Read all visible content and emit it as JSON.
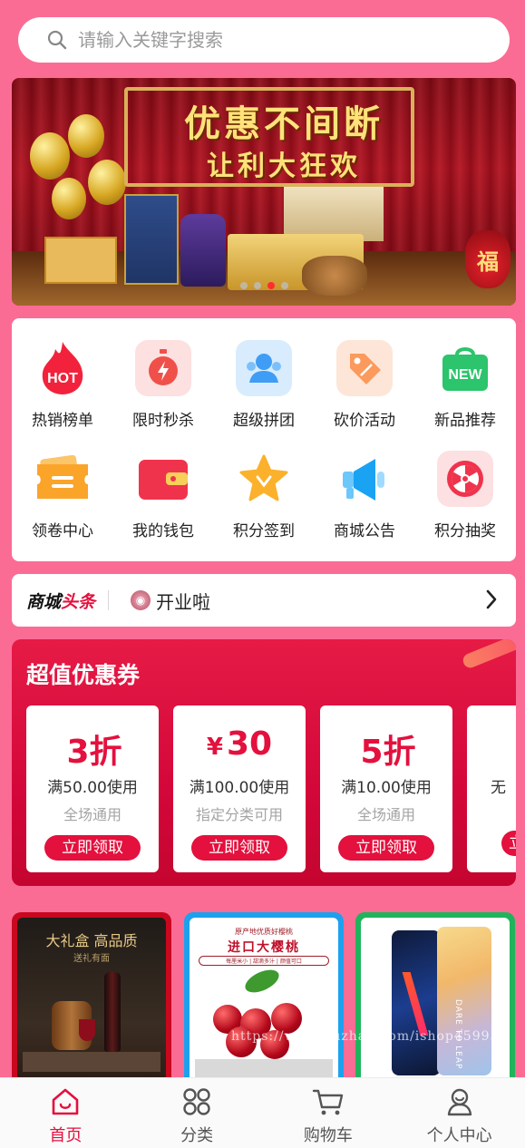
{
  "search": {
    "placeholder": "请输入关键字搜索"
  },
  "banner": {
    "title": "优惠不间断",
    "subtitle": "让利大狂欢",
    "fu": "福",
    "active_dot": 2,
    "dot_count": 4
  },
  "menu": [
    {
      "label": "热销榜单",
      "icon": "hot-flame-icon"
    },
    {
      "label": "限时秒杀",
      "icon": "stopwatch-icon"
    },
    {
      "label": "超级拼团",
      "icon": "group-users-icon"
    },
    {
      "label": "砍价活动",
      "icon": "price-tag-icon"
    },
    {
      "label": "新品推荐",
      "icon": "new-bag-icon"
    },
    {
      "label": "领卷中心",
      "icon": "ticket-icon"
    },
    {
      "label": "我的钱包",
      "icon": "wallet-icon"
    },
    {
      "label": "积分签到",
      "icon": "star-icon"
    },
    {
      "label": "商城公告",
      "icon": "megaphone-icon"
    },
    {
      "label": "积分抽奖",
      "icon": "lottery-wheel-icon"
    }
  ],
  "menu_badges": {
    "hot": "HOT",
    "new": "NEW"
  },
  "headline": {
    "brand_a": "商城",
    "brand_b": "头条",
    "text": "开业啦"
  },
  "coupons": {
    "title": "超值优惠券",
    "items": [
      {
        "value": "3",
        "unit": "折",
        "prefix": "",
        "condition": "满50.00使用",
        "scope": "全场通用",
        "button": "立即领取"
      },
      {
        "value": "30",
        "unit": "",
        "prefix": "¥",
        "condition": "满100.00使用",
        "scope": "指定分类可用",
        "button": "立即领取"
      },
      {
        "value": "5",
        "unit": "折",
        "prefix": "",
        "condition": "满10.00使用",
        "scope": "全场通用",
        "button": "立即领取"
      },
      {
        "value": "",
        "unit": "",
        "prefix": "",
        "condition": "无",
        "scope": "",
        "button": "立"
      }
    ]
  },
  "products": [
    {
      "frame_color": "#c9071f",
      "text_a": "大礼盒 高品质",
      "text_b": "送礼有面"
    },
    {
      "frame_color": "#1da1ee",
      "text_a": "原产地优质好樱桃",
      "text_b": "进口大樱桃",
      "text_c": "每厘米小 | 甜滴多汁 | 颜值可口"
    },
    {
      "frame_color": "#1fb45c",
      "text_a": "DARE TO LEAP"
    }
  ],
  "watermark": "https://www.huzhan.com/ishop45993",
  "tabs": [
    {
      "label": "首页",
      "icon": "home-icon",
      "active": true
    },
    {
      "label": "分类",
      "icon": "category-grid-icon",
      "active": false
    },
    {
      "label": "购物车",
      "icon": "cart-icon",
      "active": false
    },
    {
      "label": "个人中心",
      "icon": "user-icon",
      "active": false
    }
  ],
  "colors": {
    "page_bg": "#fb6c95",
    "accent": "#e4103d"
  }
}
